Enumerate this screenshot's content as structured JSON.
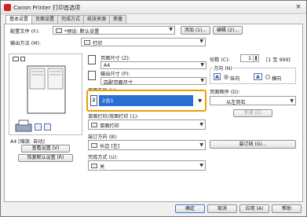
{
  "window": {
    "title": "Canon Printer 打印首选项",
    "close_glyph": "×"
  },
  "tabs": [
    {
      "label": "基本设置",
      "active": true
    },
    {
      "label": "页面设置",
      "active": false
    },
    {
      "label": "完成方式",
      "active": false
    },
    {
      "label": "纸张来源",
      "active": false
    },
    {
      "label": "质量",
      "active": false
    }
  ],
  "profile": {
    "label": "配置文件 (F):",
    "value": "*预设: 默认设置",
    "add_button": "添加 (1)...",
    "edit_button": "编辑 (2)..."
  },
  "output": {
    "label": "输出方法 (M):",
    "value": "打印"
  },
  "preview": {
    "status": "A4 [缩放: 自动]",
    "view_settings_button": "查看设置 (V)",
    "restore_defaults_button": "恢复默认设置 (R)"
  },
  "page_size": {
    "label": "页面尺寸 (Z):",
    "value": "A4"
  },
  "output_size": {
    "label": "输出尺寸 (P):",
    "value": "匹配页面尺寸"
  },
  "page_layout": {
    "label": "页面布局 (L):",
    "value": "2合1",
    "icon_text": "2"
  },
  "duplex": {
    "label": "单面打印/双面打印 (1):",
    "value": "单面打印"
  },
  "binding": {
    "label": "装订方向 (B):",
    "value": "长边 [左]"
  },
  "finishing": {
    "label": "完成方式 (U):",
    "value": "关"
  },
  "copies": {
    "label": "份数 (C):",
    "value": "1",
    "range": "[1 至 999]"
  },
  "orientation": {
    "label": "方向 (N)",
    "portrait": "纵向",
    "landscape": "横向",
    "selected": "portrait"
  },
  "page_order": {
    "label": "页面顺序 (D):",
    "value": "从左到右",
    "manual_button": "手册 (E)"
  },
  "binding_btn": {
    "label": "装订线 (G)..."
  },
  "dialog": {
    "ok": "确定",
    "cancel": "取消",
    "apply": "应用 (A)",
    "help": "帮助"
  }
}
